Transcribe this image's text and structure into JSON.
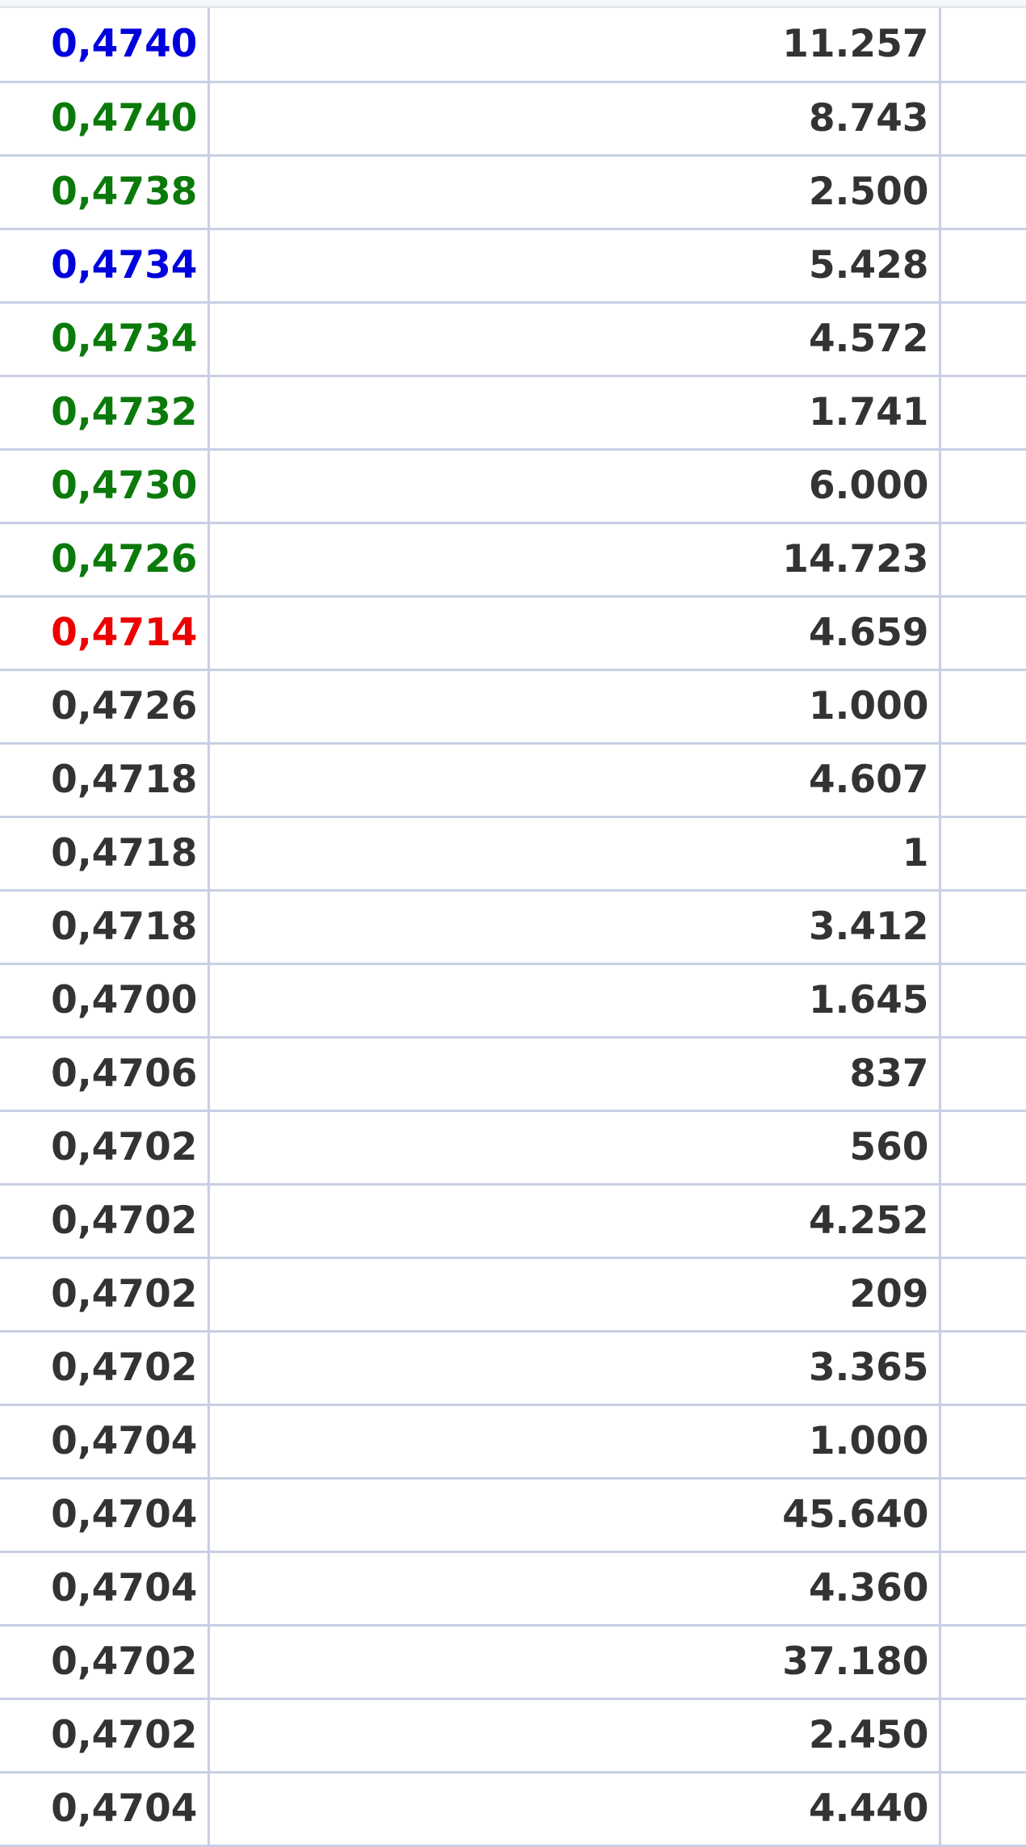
{
  "colors": {
    "uptick": "#0b7a0b",
    "buy_side": "#0000dd",
    "downtick": "#ee0000",
    "neutral": "#333333",
    "grid": "#c9cfe3"
  },
  "trades": [
    {
      "price": "0,4740",
      "volume": "11.257",
      "tone": "mid"
    },
    {
      "price": "0,4740",
      "volume": "8.743",
      "tone": "up"
    },
    {
      "price": "0,4738",
      "volume": "2.500",
      "tone": "up"
    },
    {
      "price": "0,4734",
      "volume": "5.428",
      "tone": "mid"
    },
    {
      "price": "0,4734",
      "volume": "4.572",
      "tone": "up"
    },
    {
      "price": "0,4732",
      "volume": "1.741",
      "tone": "up"
    },
    {
      "price": "0,4730",
      "volume": "6.000",
      "tone": "up"
    },
    {
      "price": "0,4726",
      "volume": "14.723",
      "tone": "up"
    },
    {
      "price": "0,4714",
      "volume": "4.659",
      "tone": "down"
    },
    {
      "price": "0,4726",
      "volume": "1.000",
      "tone": "neutral"
    },
    {
      "price": "0,4718",
      "volume": "4.607",
      "tone": "neutral"
    },
    {
      "price": "0,4718",
      "volume": "1",
      "tone": "neutral"
    },
    {
      "price": "0,4718",
      "volume": "3.412",
      "tone": "neutral"
    },
    {
      "price": "0,4700",
      "volume": "1.645",
      "tone": "neutral"
    },
    {
      "price": "0,4706",
      "volume": "837",
      "tone": "neutral"
    },
    {
      "price": "0,4702",
      "volume": "560",
      "tone": "neutral"
    },
    {
      "price": "0,4702",
      "volume": "4.252",
      "tone": "neutral"
    },
    {
      "price": "0,4702",
      "volume": "209",
      "tone": "neutral"
    },
    {
      "price": "0,4702",
      "volume": "3.365",
      "tone": "neutral"
    },
    {
      "price": "0,4704",
      "volume": "1.000",
      "tone": "neutral"
    },
    {
      "price": "0,4704",
      "volume": "45.640",
      "tone": "neutral"
    },
    {
      "price": "0,4704",
      "volume": "4.360",
      "tone": "neutral"
    },
    {
      "price": "0,4702",
      "volume": "37.180",
      "tone": "neutral"
    },
    {
      "price": "0,4702",
      "volume": "2.450",
      "tone": "neutral"
    },
    {
      "price": "0,4704",
      "volume": "4.440",
      "tone": "neutral"
    }
  ]
}
